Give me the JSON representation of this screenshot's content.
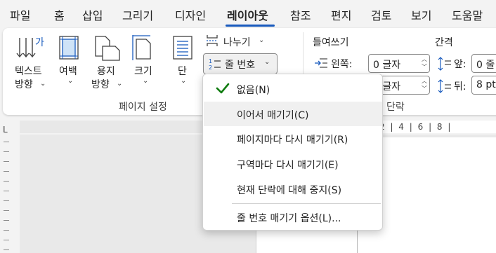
{
  "tabs": [
    {
      "label": "파일",
      "active": false
    },
    {
      "label": "홈",
      "active": false
    },
    {
      "label": "삽입",
      "active": false
    },
    {
      "label": "그리기",
      "active": false
    },
    {
      "label": "디자인",
      "active": false
    },
    {
      "label": "레이아웃",
      "active": true
    },
    {
      "label": "참조",
      "active": false
    },
    {
      "label": "편지",
      "active": false
    },
    {
      "label": "검토",
      "active": false
    },
    {
      "label": "보기",
      "active": false
    },
    {
      "label": "도움말",
      "active": false
    }
  ],
  "ribbon": {
    "page_setup": {
      "text_direction_line1": "텍스트",
      "text_direction_line2": "방향",
      "margins_label": "여백",
      "orientation_line1": "용지",
      "orientation_line2": "방향",
      "size_label": "크기",
      "columns_label": "단",
      "breaks_label": "나누기",
      "line_numbers_label": "줄 번호",
      "group_title": "페이지 설정"
    },
    "paragraph": {
      "indent_title": "들여쓰기",
      "indent_left_label": "왼쪽:",
      "indent_left_value": "0 글자",
      "indent_right_value": "0 글자",
      "spacing_title": "간격",
      "spacing_before_label": "앞:",
      "spacing_before_value": "0 줄",
      "spacing_after_label": "뒤:",
      "spacing_after_value": "8 pt",
      "group_title": "단락"
    }
  },
  "ruler": {
    "corner_glyph": "L",
    "marks_text": "2 | 4 | 6 | 8 |"
  },
  "line_numbers_menu": {
    "items": [
      {
        "label": "없음(N)",
        "checked": true
      },
      {
        "label": "이어서 매기기(C)",
        "checked": false,
        "hovered": true
      },
      {
        "label": "페이지마다 다시 매기기(R)",
        "checked": false
      },
      {
        "label": "구역마다 다시 매기기(E)",
        "checked": false
      },
      {
        "label": "현재 단락에 대해 중지(S)",
        "checked": false
      },
      {
        "label": "줄 번호 매기기 옵션(L)...",
        "checked": false
      }
    ]
  },
  "colors": {
    "accent": "#185abd",
    "check_green": "#107c10"
  }
}
